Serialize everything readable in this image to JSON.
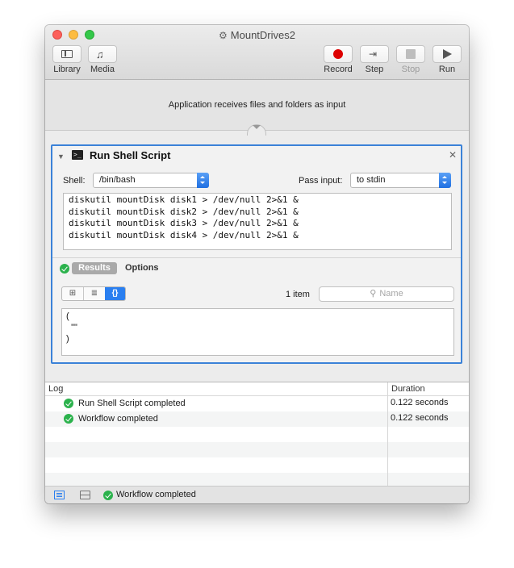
{
  "window": {
    "title": "MountDrives2"
  },
  "toolbar": {
    "library": "Library",
    "media": "Media",
    "record": "Record",
    "step": "Step",
    "stop": "Stop",
    "run": "Run"
  },
  "banner": {
    "text": "Application receives files and folders as input"
  },
  "action": {
    "title": "Run Shell Script",
    "shell_label": "Shell:",
    "shell_value": "/bin/bash",
    "pass_input_label": "Pass input:",
    "pass_input_value": "to stdin",
    "script_lines": [
      "diskutil mountDisk disk1 > /dev/null 2>&1 &",
      "diskutil mountDisk disk2 > /dev/null 2>&1 &",
      "diskutil mountDisk disk3 > /dev/null 2>&1 &",
      "diskutil mountDisk disk4 > /dev/null 2>&1 &"
    ],
    "tabs": {
      "results": "Results",
      "options": "Options"
    },
    "view_modes": [
      "⊞",
      "≣",
      "{}"
    ],
    "item_count": "1 item",
    "search_placeholder": "Name",
    "result_lines": [
      "(",
      "  \"\"",
      ")"
    ]
  },
  "log": {
    "col_log": "Log",
    "col_duration": "Duration",
    "rows": [
      {
        "message": "Run Shell Script completed",
        "duration": "0.122 seconds"
      },
      {
        "message": "Workflow completed",
        "duration": "0.122 seconds"
      }
    ]
  },
  "status": {
    "text": "Workflow completed"
  },
  "colors": {
    "accent": "#2a7ff0",
    "record": "#dd0000",
    "success": "#2bb24c"
  }
}
